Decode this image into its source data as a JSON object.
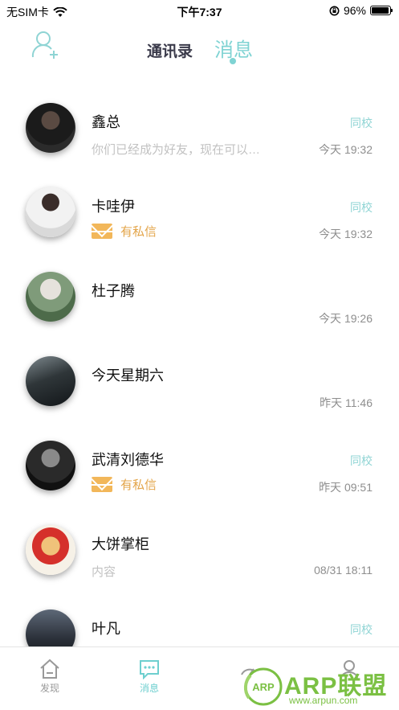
{
  "status_bar": {
    "carrier": "无SIM卡",
    "time": "下午7:37",
    "battery_percent": "96%",
    "battery_level": 0.96
  },
  "header": {
    "tabs": [
      {
        "label": "通讯录",
        "active": false
      },
      {
        "label": "消息",
        "active": true
      }
    ],
    "accent_color": "#7fd3d3"
  },
  "messages": [
    {
      "name": "鑫总",
      "tag": "同校",
      "preview": "你们已经成为好友，现在可以…",
      "preview_type": "text",
      "time": "今天 19:32",
      "avatar_icon": "avatar-photo"
    },
    {
      "name": "卡哇伊",
      "tag": "同校",
      "preview": "有私信",
      "preview_type": "mail",
      "time": "今天 19:32",
      "avatar_icon": "avatar-photo"
    },
    {
      "name": "杜子腾",
      "tag": "",
      "preview": "",
      "preview_type": "none",
      "time": "今天 19:26",
      "avatar_icon": "avatar-photo"
    },
    {
      "name": "今天星期六",
      "tag": "",
      "preview": "",
      "preview_type": "none",
      "time": "昨天 11:46",
      "avatar_icon": "avatar-photo"
    },
    {
      "name": "武清刘德华",
      "tag": "同校",
      "preview": "有私信",
      "preview_type": "mail",
      "time": "昨天 09:51",
      "avatar_icon": "avatar-photo"
    },
    {
      "name": "大饼掌柜",
      "tag": "",
      "preview": "内容",
      "preview_type": "text",
      "time": "08/31 18:11",
      "avatar_icon": "avatar-cartoon"
    },
    {
      "name": "叶凡",
      "tag": "同校",
      "preview": "",
      "preview_type": "none",
      "time": "",
      "avatar_icon": "avatar-photo"
    }
  ],
  "tabbar": {
    "items": [
      {
        "label": "发现",
        "icon": "home-icon",
        "active": false
      },
      {
        "label": "消息",
        "icon": "chat-icon",
        "active": true
      },
      {
        "label": "",
        "icon": "gauge-icon",
        "active": false
      },
      {
        "label": "",
        "icon": "profile-icon",
        "active": false
      }
    ]
  },
  "watermark": {
    "badge": "ARP",
    "text": "ARP联盟",
    "url": "www.arpun.com"
  }
}
